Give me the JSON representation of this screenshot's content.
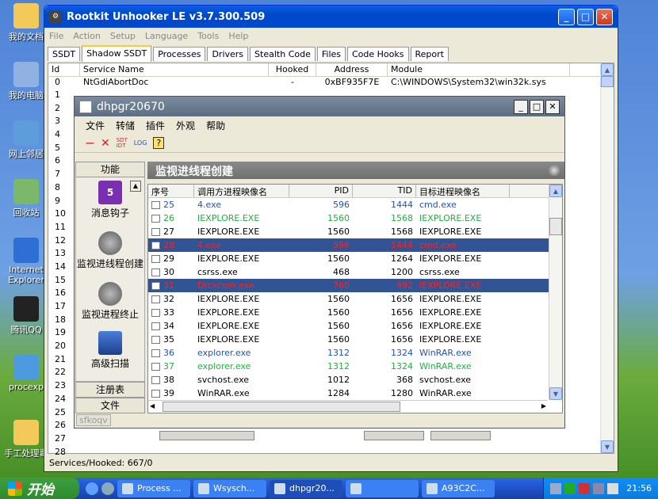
{
  "desktop_icons": [
    "我的文档",
    "我的电脑",
    "网上邻居",
    "回收站",
    "Internet Explorer",
    "腾讯QQ",
    "procexp",
    "手工处理毒"
  ],
  "rootkit": {
    "title": "Rootkit Unhooker LE v3.7.300.509",
    "menu": [
      "File",
      "Action",
      "Setup",
      "Language",
      "Tools",
      "Help"
    ],
    "tabs": [
      "SSDT",
      "Shadow SSDT",
      "Processes",
      "Drivers",
      "Stealth Code",
      "Files",
      "Code Hooks",
      "Report"
    ],
    "active_tab": "Shadow SSDT",
    "columns": [
      "Id",
      "Service Name",
      "Hooked",
      "Address",
      "Module"
    ],
    "first_row": {
      "id": "0",
      "name": "NtGdiAbortDoc",
      "hooked": "-",
      "address": "0xBF935F7E",
      "module": "C:\\WINDOWS\\System32\\win32k.sys"
    },
    "ids": [
      "1",
      "2",
      "3",
      "4",
      "5",
      "6",
      "7",
      "8",
      "9",
      "10",
      "11",
      "12",
      "13",
      "14",
      "15",
      "16",
      "17",
      "18",
      "19",
      "20",
      "21",
      "22",
      "23",
      "24",
      "25",
      "26",
      "27",
      "28"
    ],
    "status": "Services/Hooked: 667/0"
  },
  "dhpgr": {
    "title": "dhpgr20670",
    "menu": [
      "文件",
      "转储",
      "插件",
      "外观",
      "帮助"
    ],
    "toolbar": [
      "—",
      "✕",
      "SDT IDT",
      "LOG",
      "?"
    ],
    "left_panel": {
      "top_button": "功能",
      "items": [
        "消息钩子",
        "监视进线程创建",
        "监视进程终止",
        "高级扫描"
      ],
      "bottom_buttons": [
        "注册表",
        "文件"
      ]
    },
    "panel_title": "监视进线程创建",
    "columns": [
      "序号",
      "调用方进程映像名",
      "PID",
      "TID",
      "目标进程映像名"
    ],
    "rows": [
      {
        "n": "25",
        "caller": "4.exe",
        "pid": "596",
        "tid": "1444",
        "target": "cmd.exe",
        "color": "#2050c0",
        "sel": false
      },
      {
        "n": "26",
        "caller": "IEXPLORE.EXE",
        "pid": "1560",
        "tid": "1568",
        "target": "IEXPLORE.EXE",
        "color": "#20b040",
        "sel": false
      },
      {
        "n": "27",
        "caller": "IEXPLORE.EXE",
        "pid": "1560",
        "tid": "1568",
        "target": "IEXPLORE.EXE",
        "color": "#000000",
        "sel": false
      },
      {
        "n": "28",
        "caller": "4.exe",
        "pid": "596",
        "tid": "1444",
        "target": "cmd.exe",
        "color": "#ff2020",
        "sel": true
      },
      {
        "n": "29",
        "caller": "IEXPLORE.EXE",
        "pid": "1560",
        "tid": "1264",
        "target": "IEXPLORE.EXE",
        "color": "#000000",
        "sel": false
      },
      {
        "n": "30",
        "caller": "csrss.exe",
        "pid": "468",
        "tid": "1200",
        "target": "csrss.exe",
        "color": "#000000",
        "sel": false
      },
      {
        "n": "31",
        "caller": "Drcxcom.exe",
        "pid": "760",
        "tid": "992",
        "target": "IEXPLORE.EXE",
        "color": "#ff2020",
        "sel": true
      },
      {
        "n": "32",
        "caller": "IEXPLORE.EXE",
        "pid": "1560",
        "tid": "1656",
        "target": "IEXPLORE.EXE",
        "color": "#000000",
        "sel": false
      },
      {
        "n": "33",
        "caller": "IEXPLORE.EXE",
        "pid": "1560",
        "tid": "1656",
        "target": "IEXPLORE.EXE",
        "color": "#000000",
        "sel": false
      },
      {
        "n": "34",
        "caller": "IEXPLORE.EXE",
        "pid": "1560",
        "tid": "1656",
        "target": "IEXPLORE.EXE",
        "color": "#000000",
        "sel": false
      },
      {
        "n": "35",
        "caller": "IEXPLORE.EXE",
        "pid": "1560",
        "tid": "1656",
        "target": "IEXPLORE.EXE",
        "color": "#000000",
        "sel": false
      },
      {
        "n": "36",
        "caller": "explorer.exe",
        "pid": "1312",
        "tid": "1324",
        "target": "WinRAR.exe",
        "color": "#2050c0",
        "sel": false
      },
      {
        "n": "37",
        "caller": "explorer.exe",
        "pid": "1312",
        "tid": "1324",
        "target": "WinRAR.exe",
        "color": "#20b040",
        "sel": false
      },
      {
        "n": "38",
        "caller": "svchost.exe",
        "pid": "1012",
        "tid": "368",
        "target": "svchost.exe",
        "color": "#000000",
        "sel": false
      },
      {
        "n": "39",
        "caller": "WinRAR.exe",
        "pid": "1284",
        "tid": "1280",
        "target": "WinRAR.exe",
        "color": "#000000",
        "sel": false
      }
    ],
    "footer": "sfkoqv"
  },
  "taskbar": {
    "start_label": "开始",
    "tasks": [
      "Process ...",
      "Wsysch...",
      "dhpgr20...",
      "",
      "A93C2C..."
    ],
    "active_task": "dhpgr20...",
    "clock": "21:56"
  }
}
